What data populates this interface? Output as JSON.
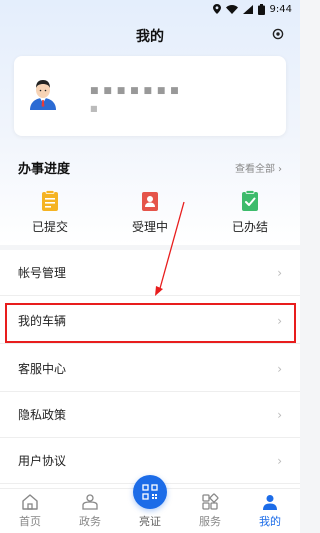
{
  "status_bar": {
    "time": "9:44",
    "icons": [
      "location-icon",
      "wifi-icon",
      "signal-icon",
      "battery-icon"
    ]
  },
  "header": {
    "title": "我的",
    "settings_icon": "settings-icon"
  },
  "profile": {
    "name_masked": "■ ■ ■ ■ ■ ■ ■",
    "sub_masked": "■"
  },
  "progress": {
    "title": "办事进度",
    "view_all": "查看全部",
    "items": [
      {
        "label": "已提交",
        "icon": "submitted-icon",
        "color": "#f5b323"
      },
      {
        "label": "受理中",
        "icon": "processing-icon",
        "color": "#e5544a"
      },
      {
        "label": "已办结",
        "icon": "completed-icon",
        "color": "#3dbb6b"
      }
    ]
  },
  "menu": {
    "items": [
      {
        "label": "帐号管理"
      },
      {
        "label": "我的车辆"
      },
      {
        "label": "客服中心"
      },
      {
        "label": "隐私政策"
      },
      {
        "label": "用户协议"
      }
    ],
    "chevron": "›"
  },
  "tabbar": {
    "tabs": [
      {
        "label": "首页",
        "icon": "home-icon"
      },
      {
        "label": "政务",
        "icon": "government-icon"
      },
      {
        "label": "亮证",
        "icon": "qr-code-icon"
      },
      {
        "label": "服务",
        "icon": "services-icon"
      },
      {
        "label": "我的",
        "icon": "profile-icon",
        "active": true
      }
    ]
  },
  "colors": {
    "accent": "#1c6ce8",
    "highlight": "#e81d1d"
  }
}
